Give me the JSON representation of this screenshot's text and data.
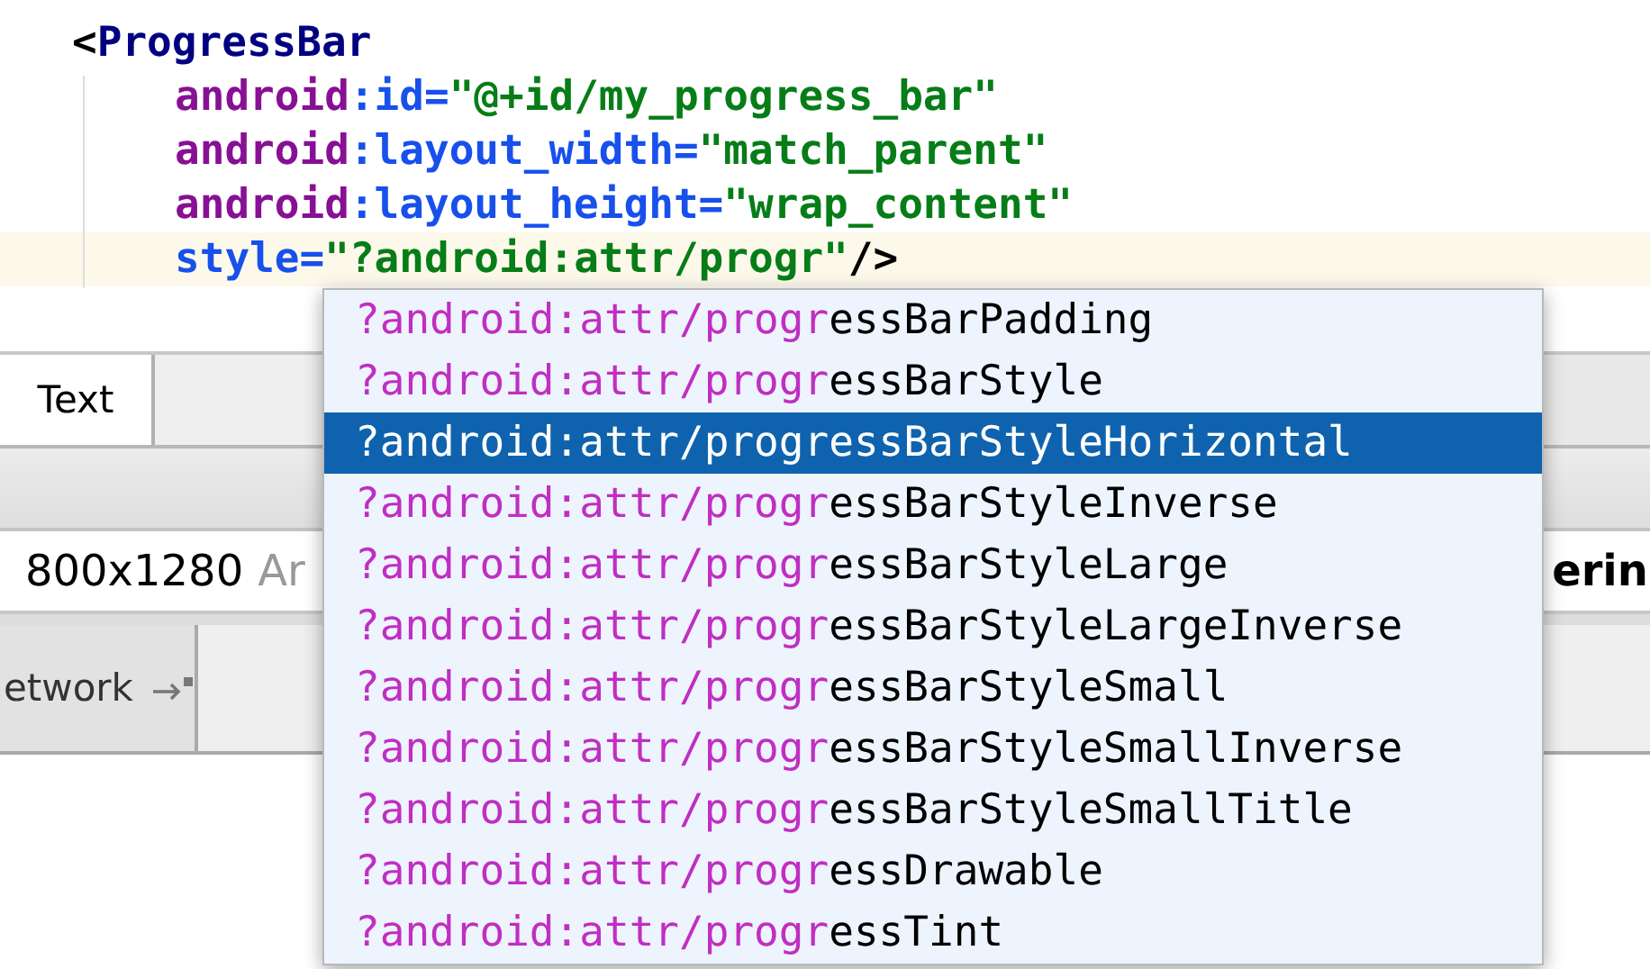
{
  "editor": {
    "lines": [
      {
        "kind": "open-tag",
        "current": false,
        "tokens": [
          {
            "kind": "punct",
            "text": "<"
          },
          {
            "kind": "tag",
            "text": "ProgressBar"
          }
        ]
      },
      {
        "kind": "attribute",
        "current": false,
        "tokens": [
          {
            "kind": "ns",
            "text": "android"
          },
          {
            "kind": "attr",
            "text": ":id="
          },
          {
            "kind": "value",
            "text": "\"@+id/my_progress_bar\""
          }
        ]
      },
      {
        "kind": "attribute",
        "current": false,
        "tokens": [
          {
            "kind": "ns",
            "text": "android"
          },
          {
            "kind": "attr",
            "text": ":layout_width="
          },
          {
            "kind": "value",
            "text": "\"match_parent\""
          }
        ]
      },
      {
        "kind": "attribute",
        "current": false,
        "tokens": [
          {
            "kind": "ns",
            "text": "android"
          },
          {
            "kind": "attr",
            "text": ":layout_height="
          },
          {
            "kind": "value",
            "text": "\"wrap_content\""
          }
        ]
      },
      {
        "kind": "attribute",
        "current": true,
        "tokens": [
          {
            "kind": "attr",
            "text": "style="
          },
          {
            "kind": "value",
            "text": "\"?android:attr/progr\""
          },
          {
            "kind": "punct",
            "text": "/>"
          }
        ]
      }
    ]
  },
  "tabs": [
    {
      "label": "Text",
      "selected": true
    }
  ],
  "device_bar": {
    "device": "800x1280",
    "suffix": "Ar",
    "right_text": "erin"
  },
  "panel_button": {
    "label": "etwork"
  },
  "completion": {
    "items": [
      {
        "match": "?android:attr/progr",
        "rest": "essBarPadding",
        "selected": false
      },
      {
        "match": "?android:attr/progr",
        "rest": "essBarStyle",
        "selected": false
      },
      {
        "match": "?android:attr/progr",
        "rest": "essBarStyleHorizontal",
        "selected": true
      },
      {
        "match": "?android:attr/progr",
        "rest": "essBarStyleInverse",
        "selected": false
      },
      {
        "match": "?android:attr/progr",
        "rest": "essBarStyleLarge",
        "selected": false
      },
      {
        "match": "?android:attr/progr",
        "rest": "essBarStyleLargeInverse",
        "selected": false
      },
      {
        "match": "?android:attr/progr",
        "rest": "essBarStyleSmall",
        "selected": false
      },
      {
        "match": "?android:attr/progr",
        "rest": "essBarStyleSmallInverse",
        "selected": false
      },
      {
        "match": "?android:attr/progr",
        "rest": "essBarStyleSmallTitle",
        "selected": false
      },
      {
        "match": "?android:attr/progr",
        "rest": "essDrawable",
        "selected": false
      },
      {
        "match": "?android:attr/progr",
        "rest": "essTint",
        "selected": false
      }
    ]
  }
}
